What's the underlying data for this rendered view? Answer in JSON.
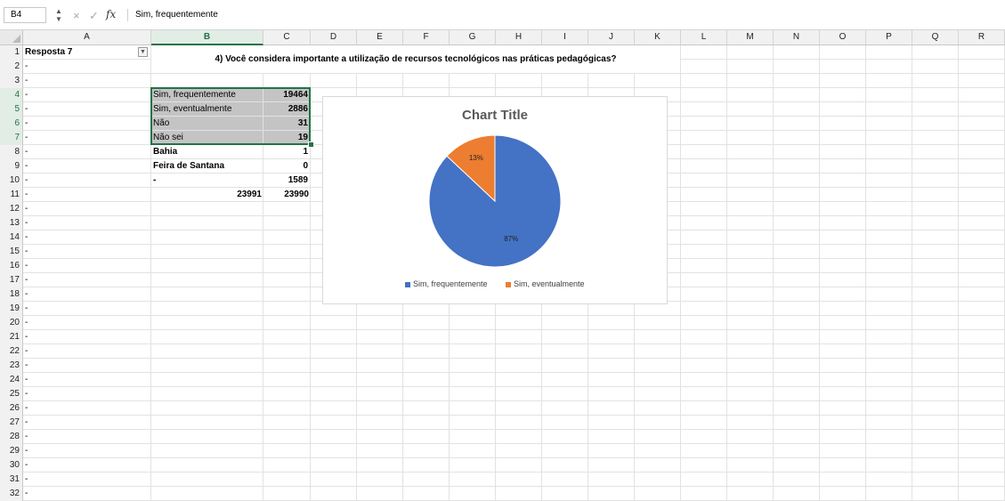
{
  "formula_bar": {
    "name_box": "B4",
    "cancel_icon": "×",
    "accept_icon": "✓",
    "fx_label": "fx",
    "content": "Sim, frequentemente"
  },
  "columns": [
    "A",
    "B",
    "C",
    "D",
    "E",
    "F",
    "G",
    "H",
    "I",
    "J",
    "K",
    "L",
    "M",
    "N",
    "O",
    "P",
    "Q",
    "R"
  ],
  "selected_column": "B",
  "rows": [
    "1",
    "2",
    "3",
    "4",
    "5",
    "6",
    "7",
    "8",
    "9",
    "10",
    "11",
    "12",
    "13",
    "14",
    "15",
    "16",
    "17",
    "18",
    "19",
    "20",
    "21",
    "22",
    "23",
    "24",
    "25",
    "26",
    "27",
    "28",
    "29",
    "30",
    "31",
    "32"
  ],
  "selected_rows": [
    "4",
    "5",
    "6",
    "7"
  ],
  "header_cell": "Resposta 7",
  "column_a_values": [
    "-",
    "-",
    "-",
    "-",
    "-",
    "-",
    "-",
    "-",
    "-",
    "-",
    "-",
    "-",
    "-",
    "-",
    "-",
    "-",
    "-",
    "-",
    "-",
    "-",
    "-",
    "-",
    "-",
    "-",
    "-",
    "-",
    "-",
    "-",
    "-",
    "-",
    "-"
  ],
  "question_title": "4) Você considera importante a utilização de recursos tecnológicos nas práticas pedagógicas?",
  "table": [
    {
      "row": "4",
      "b": "Sim, frequentemente",
      "c": "19464",
      "shaded": true,
      "bold": false
    },
    {
      "row": "5",
      "b": "Sim, eventualmente",
      "c": "2886",
      "shaded": true,
      "bold": false
    },
    {
      "row": "6",
      "b": "Não",
      "c": "31",
      "shaded": true,
      "bold": false
    },
    {
      "row": "7",
      "b": "Não sei",
      "c": "19",
      "shaded": true,
      "bold": false
    },
    {
      "row": "8",
      "b": "Bahia",
      "c": "1",
      "shaded": false,
      "bold": true
    },
    {
      "row": "9",
      "b": "Feira de Santana",
      "c": "0",
      "shaded": false,
      "bold": true
    },
    {
      "row": "10",
      "b": "-",
      "c": "1589",
      "shaded": false,
      "bold": true
    }
  ],
  "totals": {
    "b": "23991",
    "c": "23990"
  },
  "chart": {
    "title": "Chart Title",
    "legend": [
      {
        "label": "Sim, frequentemente",
        "color": "#4472c4"
      },
      {
        "label": "Sim, eventualmente",
        "color": "#ed7d31"
      }
    ]
  },
  "chart_data": {
    "type": "pie",
    "title": "Chart Title",
    "categories": [
      "Sim, frequentemente",
      "Sim, eventualmente"
    ],
    "values": [
      87,
      13
    ],
    "data_labels": [
      "87%",
      "13%"
    ],
    "colors": [
      "#4472c4",
      "#ed7d31"
    ],
    "legend_position": "bottom"
  }
}
